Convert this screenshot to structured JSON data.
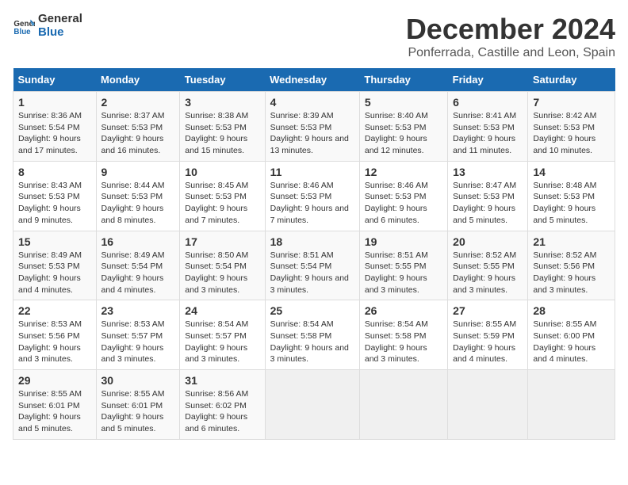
{
  "logo": {
    "line1": "General",
    "line2": "Blue"
  },
  "title": "December 2024",
  "subtitle": "Ponferrada, Castille and Leon, Spain",
  "days_of_week": [
    "Sunday",
    "Monday",
    "Tuesday",
    "Wednesday",
    "Thursday",
    "Friday",
    "Saturday"
  ],
  "weeks": [
    [
      {
        "day": "1",
        "sunrise": "8:36 AM",
        "sunset": "5:54 PM",
        "daylight": "9 hours and 17 minutes."
      },
      {
        "day": "2",
        "sunrise": "8:37 AM",
        "sunset": "5:53 PM",
        "daylight": "9 hours and 16 minutes."
      },
      {
        "day": "3",
        "sunrise": "8:38 AM",
        "sunset": "5:53 PM",
        "daylight": "9 hours and 15 minutes."
      },
      {
        "day": "4",
        "sunrise": "8:39 AM",
        "sunset": "5:53 PM",
        "daylight": "9 hours and 13 minutes."
      },
      {
        "day": "5",
        "sunrise": "8:40 AM",
        "sunset": "5:53 PM",
        "daylight": "9 hours and 12 minutes."
      },
      {
        "day": "6",
        "sunrise": "8:41 AM",
        "sunset": "5:53 PM",
        "daylight": "9 hours and 11 minutes."
      },
      {
        "day": "7",
        "sunrise": "8:42 AM",
        "sunset": "5:53 PM",
        "daylight": "9 hours and 10 minutes."
      }
    ],
    [
      {
        "day": "8",
        "sunrise": "8:43 AM",
        "sunset": "5:53 PM",
        "daylight": "9 hours and 9 minutes."
      },
      {
        "day": "9",
        "sunrise": "8:44 AM",
        "sunset": "5:53 PM",
        "daylight": "9 hours and 8 minutes."
      },
      {
        "day": "10",
        "sunrise": "8:45 AM",
        "sunset": "5:53 PM",
        "daylight": "9 hours and 7 minutes."
      },
      {
        "day": "11",
        "sunrise": "8:46 AM",
        "sunset": "5:53 PM",
        "daylight": "9 hours and 7 minutes."
      },
      {
        "day": "12",
        "sunrise": "8:46 AM",
        "sunset": "5:53 PM",
        "daylight": "9 hours and 6 minutes."
      },
      {
        "day": "13",
        "sunrise": "8:47 AM",
        "sunset": "5:53 PM",
        "daylight": "9 hours and 5 minutes."
      },
      {
        "day": "14",
        "sunrise": "8:48 AM",
        "sunset": "5:53 PM",
        "daylight": "9 hours and 5 minutes."
      }
    ],
    [
      {
        "day": "15",
        "sunrise": "8:49 AM",
        "sunset": "5:53 PM",
        "daylight": "9 hours and 4 minutes."
      },
      {
        "day": "16",
        "sunrise": "8:49 AM",
        "sunset": "5:54 PM",
        "daylight": "9 hours and 4 minutes."
      },
      {
        "day": "17",
        "sunrise": "8:50 AM",
        "sunset": "5:54 PM",
        "daylight": "9 hours and 3 minutes."
      },
      {
        "day": "18",
        "sunrise": "8:51 AM",
        "sunset": "5:54 PM",
        "daylight": "9 hours and 3 minutes."
      },
      {
        "day": "19",
        "sunrise": "8:51 AM",
        "sunset": "5:55 PM",
        "daylight": "9 hours and 3 minutes."
      },
      {
        "day": "20",
        "sunrise": "8:52 AM",
        "sunset": "5:55 PM",
        "daylight": "9 hours and 3 minutes."
      },
      {
        "day": "21",
        "sunrise": "8:52 AM",
        "sunset": "5:56 PM",
        "daylight": "9 hours and 3 minutes."
      }
    ],
    [
      {
        "day": "22",
        "sunrise": "8:53 AM",
        "sunset": "5:56 PM",
        "daylight": "9 hours and 3 minutes."
      },
      {
        "day": "23",
        "sunrise": "8:53 AM",
        "sunset": "5:57 PM",
        "daylight": "9 hours and 3 minutes."
      },
      {
        "day": "24",
        "sunrise": "8:54 AM",
        "sunset": "5:57 PM",
        "daylight": "9 hours and 3 minutes."
      },
      {
        "day": "25",
        "sunrise": "8:54 AM",
        "sunset": "5:58 PM",
        "daylight": "9 hours and 3 minutes."
      },
      {
        "day": "26",
        "sunrise": "8:54 AM",
        "sunset": "5:58 PM",
        "daylight": "9 hours and 3 minutes."
      },
      {
        "day": "27",
        "sunrise": "8:55 AM",
        "sunset": "5:59 PM",
        "daylight": "9 hours and 4 minutes."
      },
      {
        "day": "28",
        "sunrise": "8:55 AM",
        "sunset": "6:00 PM",
        "daylight": "9 hours and 4 minutes."
      }
    ],
    [
      {
        "day": "29",
        "sunrise": "8:55 AM",
        "sunset": "6:01 PM",
        "daylight": "9 hours and 5 minutes."
      },
      {
        "day": "30",
        "sunrise": "8:55 AM",
        "sunset": "6:01 PM",
        "daylight": "9 hours and 5 minutes."
      },
      {
        "day": "31",
        "sunrise": "8:56 AM",
        "sunset": "6:02 PM",
        "daylight": "9 hours and 6 minutes."
      },
      null,
      null,
      null,
      null
    ]
  ],
  "labels": {
    "sunrise": "Sunrise:",
    "sunset": "Sunset:",
    "daylight": "Daylight:"
  }
}
